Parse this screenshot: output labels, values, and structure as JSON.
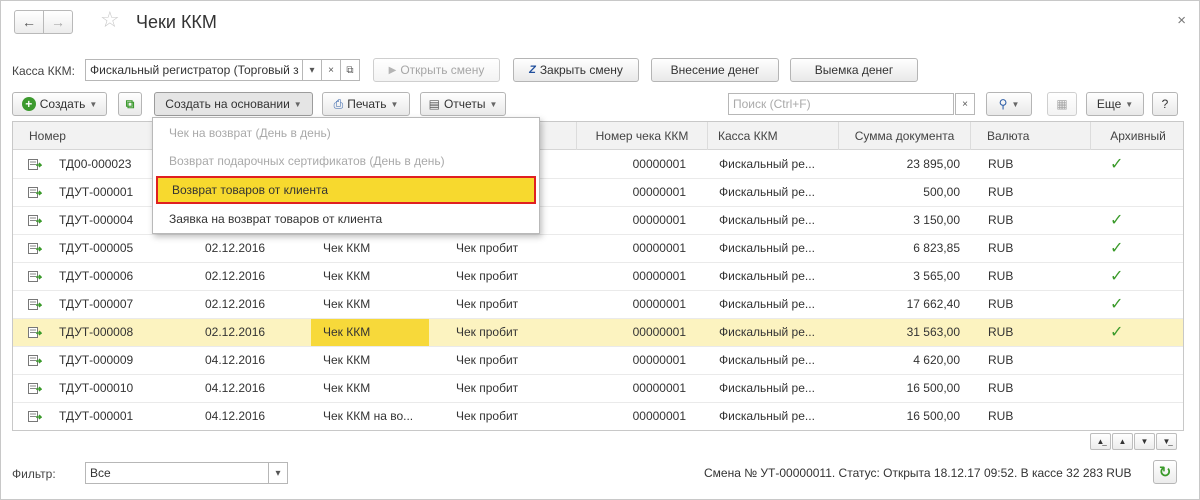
{
  "window": {
    "title": "Чеки ККМ"
  },
  "toolbar_top": {
    "kassa_label": "Касса ККМ:",
    "kassa_value": "Фискальный регистратор (Торговый з",
    "open_shift": "Открыть смену",
    "close_shift": "Закрыть смену",
    "deposit": "Внесение денег",
    "withdraw": "Выемка денег"
  },
  "toolbar": {
    "create": "Создать",
    "create_based_on": "Создать на основании",
    "print": "Печать",
    "reports": "Отчеты",
    "search_placeholder": "Поиск (Ctrl+F)",
    "more": "Еще",
    "help": "?"
  },
  "dropdown": {
    "items": [
      {
        "label": "Чек на возврат (День в день)",
        "state": "disabled"
      },
      {
        "label": "Возврат подарочных сертификатов (День в день)",
        "state": "disabled"
      },
      {
        "label": "Возврат товаров от клиента",
        "state": "active"
      },
      {
        "label": "Заявка на возврат товаров от клиента",
        "state": "normal"
      }
    ]
  },
  "table": {
    "columns": [
      "Номер",
      "Номер чека ККМ",
      "Касса ККМ",
      "Сумма документа",
      "Валюта",
      "Архивный"
    ],
    "rows": [
      {
        "num": "ТД00-000023",
        "date": "",
        "op": "",
        "status": "",
        "check_no": "00000001",
        "kassa": "Фискальный ре...",
        "sum": "23 895,00",
        "cur": "RUB",
        "archived": "✓"
      },
      {
        "num": "ТДУТ-000001",
        "date": "",
        "op": "",
        "status": "",
        "check_no": "00000001",
        "kassa": "Фискальный ре...",
        "sum": "500,00",
        "cur": "RUB",
        "archived": ""
      },
      {
        "num": "ТДУТ-000004",
        "date": "",
        "op": "",
        "status": "",
        "check_no": "00000001",
        "kassa": "Фискальный ре...",
        "sum": "3 150,00",
        "cur": "RUB",
        "archived": "✓"
      },
      {
        "num": "ТДУТ-000005",
        "date": "02.12.2016",
        "op": "Чек ККМ",
        "status": "Чек пробит",
        "check_no": "00000001",
        "kassa": "Фискальный ре...",
        "sum": "6 823,85",
        "cur": "RUB",
        "archived": "✓"
      },
      {
        "num": "ТДУТ-000006",
        "date": "02.12.2016",
        "op": "Чек ККМ",
        "status": "Чек пробит",
        "check_no": "00000001",
        "kassa": "Фискальный ре...",
        "sum": "3 565,00",
        "cur": "RUB",
        "archived": "✓"
      },
      {
        "num": "ТДУТ-000007",
        "date": "02.12.2016",
        "op": "Чек ККМ",
        "status": "Чек пробит",
        "check_no": "00000001",
        "kassa": "Фискальный ре...",
        "sum": "17 662,40",
        "cur": "RUB",
        "archived": "✓"
      },
      {
        "num": "ТДУТ-000008",
        "date": "02.12.2016",
        "op": "Чек ККМ",
        "status": "Чек пробит",
        "check_no": "00000001",
        "kassa": "Фискальный ре...",
        "sum": "31 563,00",
        "cur": "RUB",
        "archived": "✓"
      },
      {
        "num": "ТДУТ-000009",
        "date": "04.12.2016",
        "op": "Чек ККМ",
        "status": "Чек пробит",
        "check_no": "00000001",
        "kassa": "Фискальный ре...",
        "sum": "4 620,00",
        "cur": "RUB",
        "archived": ""
      },
      {
        "num": "ТДУТ-000010",
        "date": "04.12.2016",
        "op": "Чек ККМ",
        "status": "Чек пробит",
        "check_no": "00000001",
        "kassa": "Фискальный ре...",
        "sum": "16 500,00",
        "cur": "RUB",
        "archived": ""
      },
      {
        "num": "ТДУТ-000001",
        "date": "04.12.2016",
        "op": "Чек ККМ на во...",
        "status": "Чек пробит",
        "check_no": "00000001",
        "kassa": "Фискальный ре...",
        "sum": "16 500,00",
        "cur": "RUB",
        "archived": ""
      }
    ],
    "selected_row": 6
  },
  "footer": {
    "filter_label": "Фильтр:",
    "filter_value": "Все",
    "status": "Смена № УТ-00000011. Статус: Открыта 18.12.17 09:52. В кассе 32 283 RUB"
  }
}
